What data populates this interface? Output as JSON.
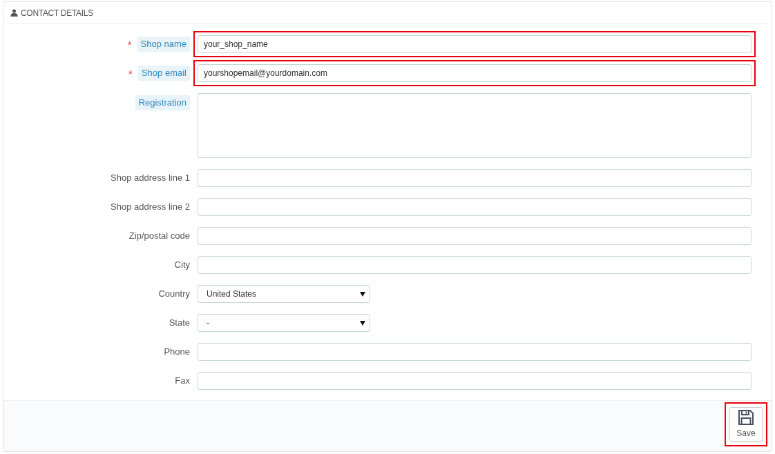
{
  "panel": {
    "title": "CONTACT DETAILS"
  },
  "fields": [
    {
      "kind": "text",
      "label": "Shop name",
      "required_mark": "*",
      "hint": true,
      "value": "your_shop_name",
      "highlighted": true
    },
    {
      "kind": "text",
      "label": "Shop email",
      "required_mark": "*",
      "hint": true,
      "value": "yourshopemail@yourdomain.com",
      "highlighted": true
    },
    {
      "kind": "textarea",
      "label": "Registration",
      "hint": true,
      "highlighted": false
    },
    {
      "kind": "text",
      "label": "Shop address line 1",
      "hint": false,
      "highlighted": false
    },
    {
      "kind": "text",
      "label": "Shop address line 2",
      "hint": false,
      "highlighted": false
    },
    {
      "kind": "text",
      "label": "Zip/postal code",
      "hint": false,
      "highlighted": false
    },
    {
      "kind": "text",
      "label": "City",
      "hint": false,
      "highlighted": false
    },
    {
      "kind": "select",
      "label": "Country",
      "hint": false,
      "value": "United States",
      "highlighted": false
    },
    {
      "kind": "select",
      "label": "State",
      "hint": false,
      "value": "-",
      "highlighted": false
    },
    {
      "kind": "text",
      "label": "Phone",
      "hint": false,
      "highlighted": false
    },
    {
      "kind": "text",
      "label": "Fax",
      "hint": false,
      "highlighted": false
    }
  ],
  "save_button": {
    "label": "Save",
    "highlighted": true
  }
}
